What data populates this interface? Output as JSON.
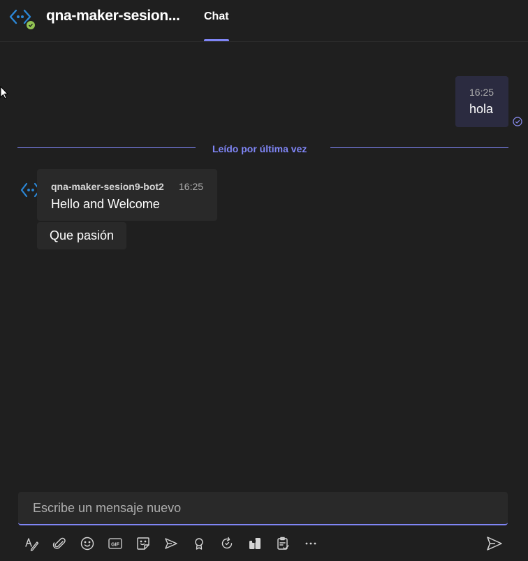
{
  "header": {
    "title": "qna-maker-sesion...",
    "tabs": [
      {
        "label": "Chat",
        "active": true
      }
    ]
  },
  "messages": {
    "outgoing": {
      "time": "16:25",
      "text": "hola",
      "status_icon": "read-check-icon"
    },
    "divider_label": "Leído por última vez",
    "incoming": {
      "sender": "qna-maker-sesion9-bot2",
      "time": "16:25",
      "text": "Hello and Welcome",
      "suggested_action": "Que pasión"
    }
  },
  "compose": {
    "placeholder": "Escribe un mensaje nuevo",
    "value": ""
  },
  "toolbar": {
    "icons": [
      "format-icon",
      "attach-icon",
      "emoji-icon",
      "gif-icon",
      "sticker-icon",
      "schedule-meeting-icon",
      "praise-icon",
      "loop-icon",
      "apps-icon",
      "approvals-icon",
      "more-options-icon"
    ],
    "send_icon": "send-icon"
  },
  "colors": {
    "background": "#1f1f1f",
    "accent": "#7f85f5",
    "outgoing_bubble": "#2b2b40",
    "incoming_bubble": "#292929",
    "presence_available": "#92c353"
  }
}
